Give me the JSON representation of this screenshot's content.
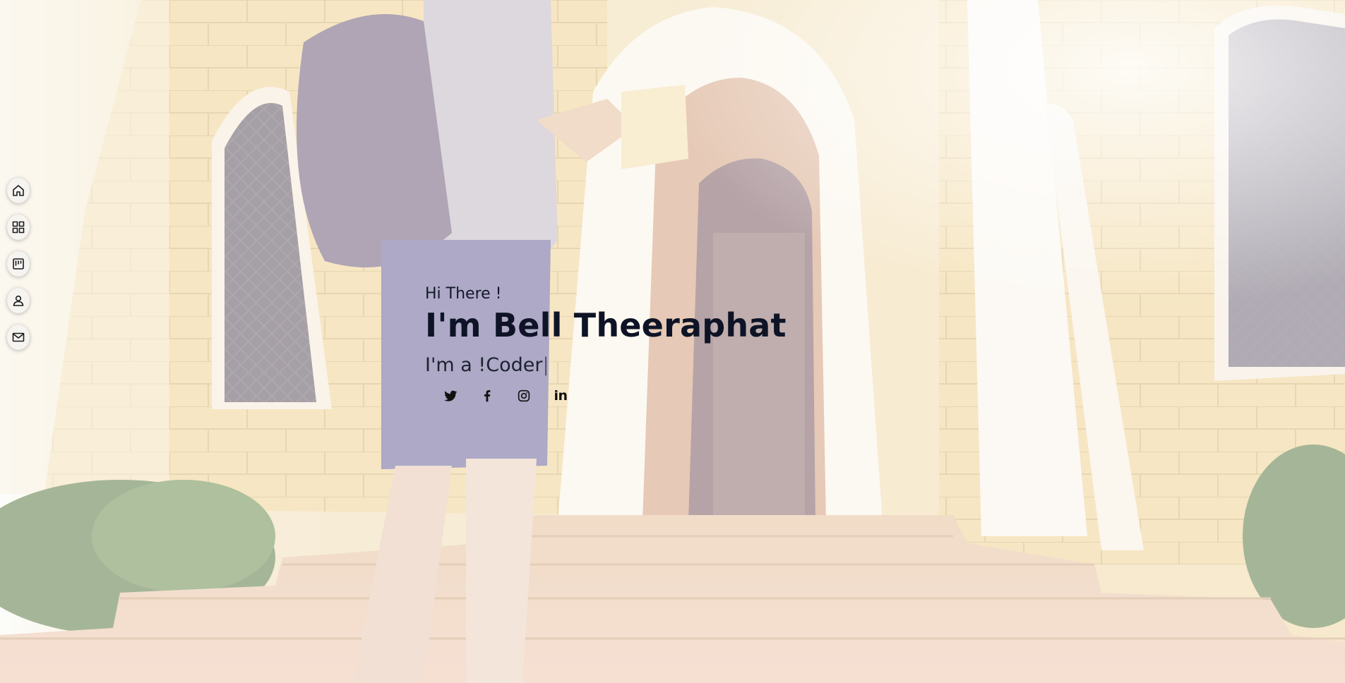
{
  "nav": {
    "items": [
      {
        "icon": "home-icon"
      },
      {
        "icon": "grid-icon"
      },
      {
        "icon": "kanban-icon"
      },
      {
        "icon": "user-icon"
      },
      {
        "icon": "mail-icon"
      }
    ]
  },
  "hero": {
    "greeting": "Hi There !",
    "name": "I'm Bell Theeraphat",
    "role_prefix": "I'm a ",
    "role_typed": "!Coder",
    "cursor": "|"
  },
  "socials": [
    {
      "icon": "twitter-icon"
    },
    {
      "icon": "facebook-icon"
    },
    {
      "icon": "instagram-icon"
    },
    {
      "icon": "linkedin-icon",
      "text": "in"
    }
  ],
  "colors": {
    "heading": "#0e1426",
    "wall": "#f0d9a0",
    "overlay": "#ffffff"
  }
}
